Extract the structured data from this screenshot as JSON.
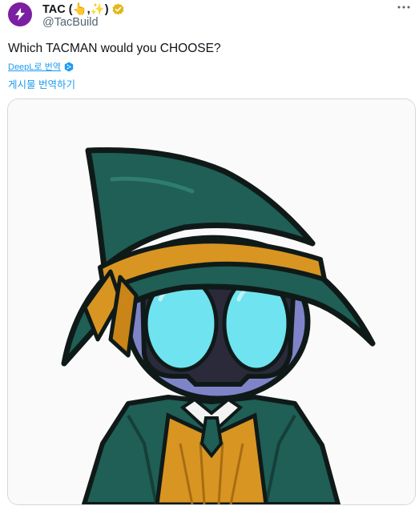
{
  "author": {
    "display_name": "TAC (👆,✨)",
    "handle": "@TacBuild",
    "avatar_icon": "tac-logo-icon",
    "avatar_color": "#7b1fa2",
    "verified_color": "#e2b719"
  },
  "tweet": {
    "text": "Which TACMAN would you CHOOSE?",
    "deepl_label": "DeepL로 번역",
    "translate_label": "게시물 번역하기"
  },
  "media": {
    "image_icon": "tacman-wizard-character",
    "hat_color": "#1f5f55",
    "band_color": "#d89522",
    "eye_color": "#6fe3ef",
    "face_color": "#7f84c9"
  },
  "accent_color": "#1d9bf0"
}
